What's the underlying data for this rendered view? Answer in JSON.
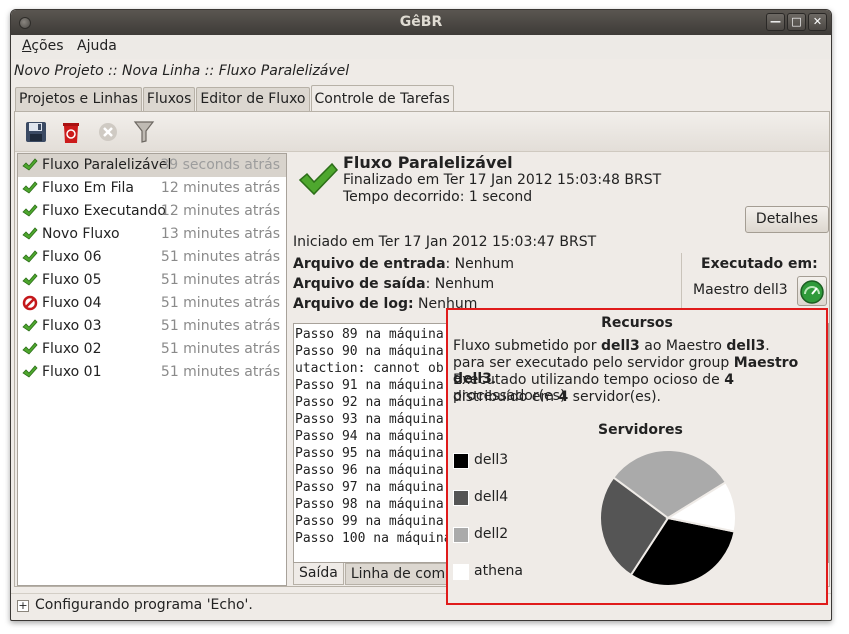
{
  "window": {
    "title": "GêBR"
  },
  "menu": [
    {
      "label": "Ações",
      "mnemonic": "A",
      "rest": "ções"
    },
    {
      "label": "Ajuda",
      "mnemonic": "j",
      "pre": "A",
      "rest": "uda"
    }
  ],
  "breadcrumb": "Novo Projeto :: Nova Linha :: Fluxo Paralelizável",
  "tabs": [
    "Projetos e Linhas",
    "Fluxos",
    "Editor de Fluxo",
    "Controle de Tarefas"
  ],
  "toolbar": {
    "icons": [
      "save-icon",
      "delete-icon",
      "cancel-icon",
      "filter-icon"
    ]
  },
  "jobs": [
    {
      "name": "Fluxo Paralelizável",
      "time": "39 seconds atrás",
      "status": "finished",
      "selected": true
    },
    {
      "name": "Fluxo Em Fila",
      "time": "12 minutes atrás",
      "status": "finished"
    },
    {
      "name": "Fluxo Executando",
      "time": "12 minutes atrás",
      "status": "finished"
    },
    {
      "name": "Novo Fluxo",
      "time": "13 minutes atrás",
      "status": "finished"
    },
    {
      "name": "Fluxo 06",
      "time": "51 minutes atrás",
      "status": "finished"
    },
    {
      "name": "Fluxo 05",
      "time": "51 minutes atrás",
      "status": "finished"
    },
    {
      "name": "Fluxo 04",
      "time": "51 minutes atrás",
      "status": "failed"
    },
    {
      "name": "Fluxo 03",
      "time": "51 minutes atrás",
      "status": "finished"
    },
    {
      "name": "Fluxo 02",
      "time": "51 minutes atrás",
      "status": "finished"
    },
    {
      "name": "Fluxo 01",
      "time": "51 minutes atrás",
      "status": "finished"
    }
  ],
  "detail": {
    "title": "Fluxo Paralelizável",
    "finished": "Finalizado em Ter 17 Jan 2012 15:03:48 BRST",
    "elapsed": "Tempo decorrido: 1 second",
    "details_button": "Detalhes",
    "started": "Iniciado em Ter 17 Jan 2012 15:03:47 BRST",
    "input_label": "Arquivo de entrada",
    "input_value": ": Nenhum",
    "output_label": "Arquivo de saída",
    "output_value": ": Nenhum",
    "log_label": "Arquivo de log:",
    "log_value": " Nenhum",
    "executed_on_label": "Executado em:",
    "executed_on_value": "Maestro dell3"
  },
  "log_lines": [
    "Passo 89 na máquina",
    "Passo 90 na máquina",
    "utaction: cannot ob",
    "Passo 91 na máquina",
    "Passo 92 na máquina",
    "Passo 93 na máquina",
    "Passo 94 na máquina",
    "Passo 95 na máquina",
    "Passo 96 na máquina",
    "Passo 97 na máquina",
    "Passo 98 na máquina",
    "Passo 99 na máquina",
    "Passo 100 na máquina"
  ],
  "output_tabs": [
    "Saída",
    "Linha de comando"
  ],
  "status_text": "Configurando programa 'Echo'.",
  "resources": {
    "title": "Recursos",
    "l1a": "Fluxo submetido por ",
    "l1b": "dell3",
    "l1c": " ao Maestro ",
    "l1d": "dell3",
    "l1e": ".",
    "l2a": "para ser executado pelo servidor group ",
    "l2b": "Maestro dell3",
    "l2c": ".",
    "l3a": "Executado utilizando tempo ocioso de ",
    "l3b": "4",
    "l3c": " processador(es)",
    "l4a": "distribuído em ",
    "l4b": "4",
    "l4c": " servidor(es).",
    "servers_title": "Servidores"
  },
  "chart_data": {
    "type": "pie",
    "title": "Servidores",
    "categories": [
      "dell3",
      "dell4",
      "dell2",
      "athena"
    ],
    "values": [
      31,
      26,
      31,
      12
    ],
    "colors": [
      "#000000",
      "#555555",
      "#aaaaaa",
      "#ffffff"
    ]
  }
}
